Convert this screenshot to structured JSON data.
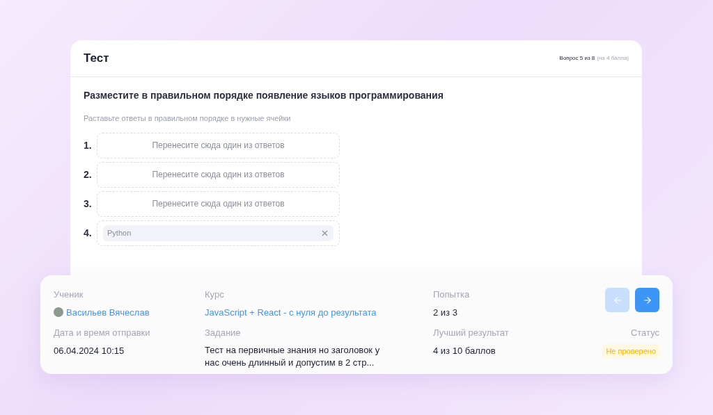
{
  "test": {
    "title": "Тест",
    "progress": "Вопрос 5 из 8",
    "points": "(на 4 балла)"
  },
  "question": {
    "text": "Разместите в правильном порядке появление языков программирования",
    "hint": "Раставьте ответы в правильном порядке в нужные ячейки",
    "slots": [
      {
        "number": "1.",
        "kind": "empty",
        "placeholder": "Перенесите сюда один из ответов"
      },
      {
        "number": "2.",
        "kind": "empty",
        "placeholder": "Перенесите сюда один из ответов"
      },
      {
        "number": "3.",
        "kind": "empty",
        "placeholder": "Перенесите сюда один из ответов"
      },
      {
        "number": "4.",
        "kind": "filled",
        "answer": "Python"
      }
    ]
  },
  "details": {
    "student": {
      "label": "Ученик",
      "value": "Васильев Вячеслав"
    },
    "course": {
      "label": "Курс",
      "value": "JavaScript + React - с нуля до результата"
    },
    "attempt": {
      "label": "Попытка",
      "value": "2 из 3"
    },
    "sent": {
      "label": "Дата и время отправки",
      "value": "06.04.2024 10:15"
    },
    "task": {
      "label": "Задание",
      "value": "Тест на первичные знания но заголовок у нас очень длинный и допустим в 2 стр..."
    },
    "best": {
      "label": "Лучший результат",
      "value": "4 из 10 баллов"
    },
    "status": {
      "label": "Статус",
      "value": "Не проверено"
    },
    "nav": {
      "prev_disabled": true,
      "next_disabled": false
    }
  }
}
